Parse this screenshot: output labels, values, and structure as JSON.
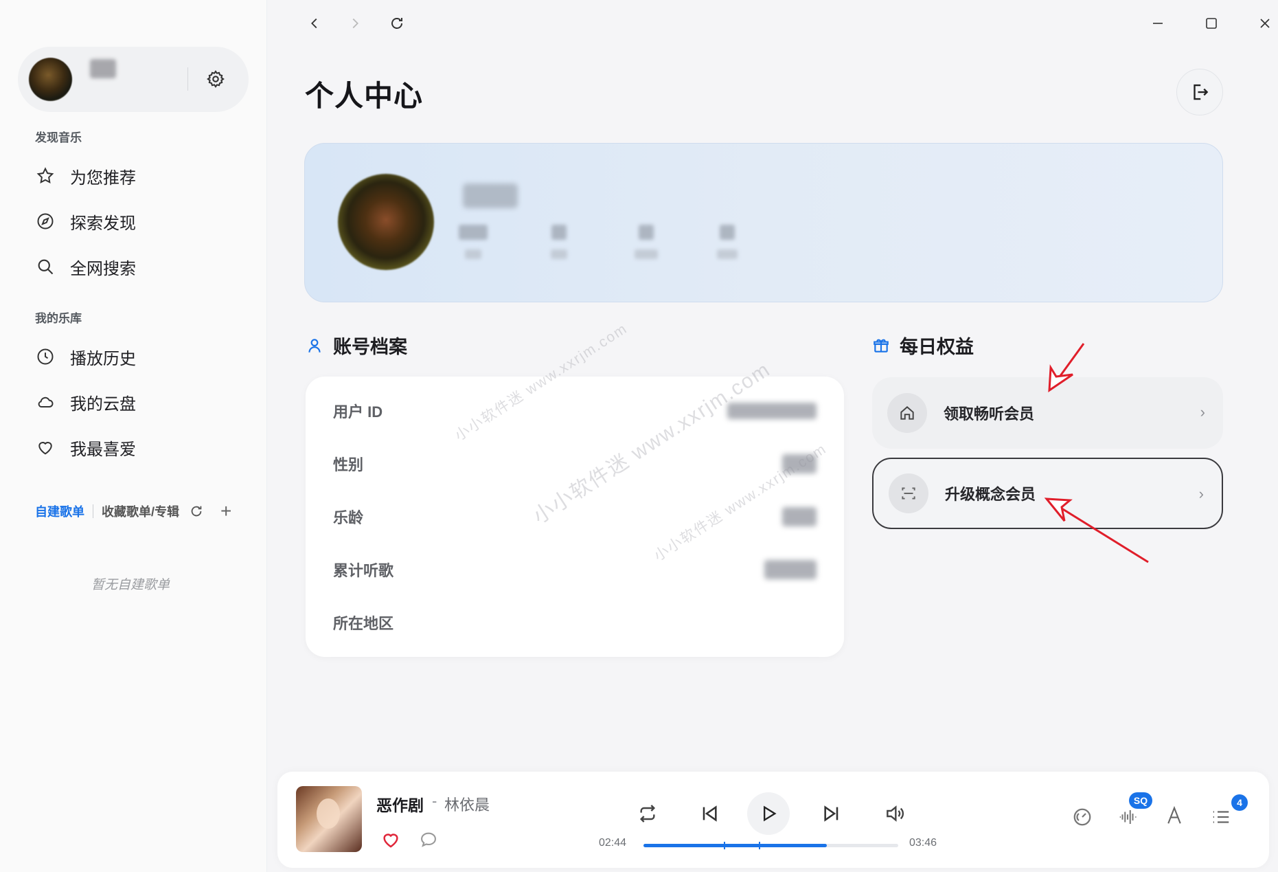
{
  "sidebar": {
    "sections": {
      "discover": "发现音乐",
      "library": "我的乐库"
    },
    "discover_items": [
      {
        "label": "为您推荐",
        "icon": "star-icon"
      },
      {
        "label": "探索发现",
        "icon": "compass-icon"
      },
      {
        "label": "全网搜索",
        "icon": "search-icon"
      }
    ],
    "library_items": [
      {
        "label": "播放历史",
        "icon": "clock-icon"
      },
      {
        "label": "我的云盘",
        "icon": "cloud-icon"
      },
      {
        "label": "我最喜爱",
        "icon": "heart-icon"
      }
    ],
    "playlist_tabs": {
      "created": "自建歌单",
      "collected": "收藏歌单/专辑"
    },
    "empty_note": "暂无自建歌单"
  },
  "header": {
    "title": "个人中心"
  },
  "account": {
    "heading": "账号档案",
    "rows": [
      {
        "label": "用户 ID"
      },
      {
        "label": "性别"
      },
      {
        "label": "乐龄"
      },
      {
        "label": "累计听歌"
      },
      {
        "label": "所在地区"
      }
    ]
  },
  "benefits": {
    "heading": "每日权益",
    "items": [
      {
        "label": "领取畅听会员",
        "icon": "home-icon"
      },
      {
        "label": "升级概念会员",
        "icon": "scan-icon"
      }
    ]
  },
  "watermark": {
    "text1": "小小软件迷 www.xxrjm.com"
  },
  "player": {
    "song": "恶作剧",
    "separator": "-",
    "artist": "林依晨",
    "current_time": "02:44",
    "total_time": "03:46",
    "progress": 0.72,
    "quality_badge": "SQ",
    "queue_count": "4"
  },
  "colors": {
    "accent": "#1a73e8",
    "annotation_arrow": "#e01e2a"
  }
}
